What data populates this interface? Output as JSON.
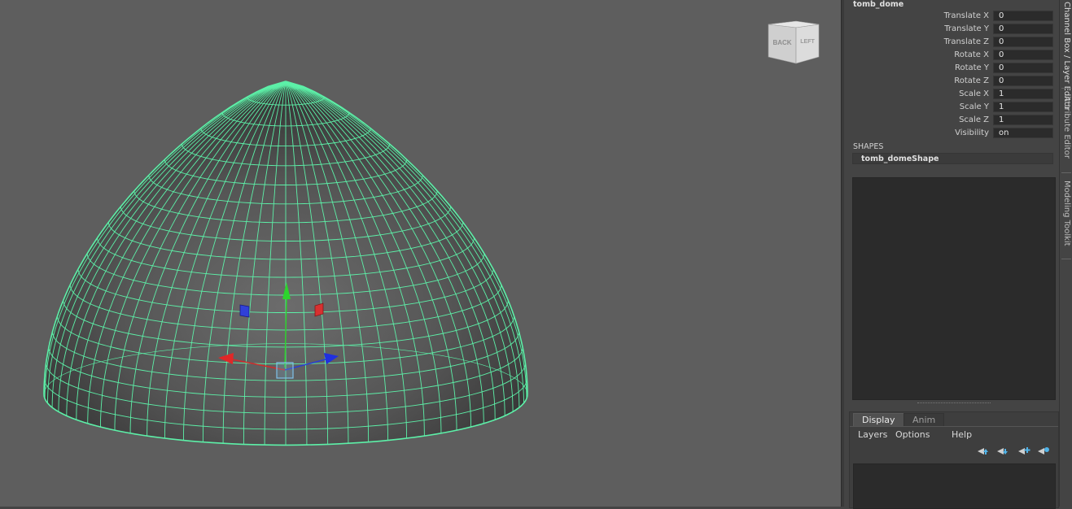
{
  "viewport": {
    "wireframe_color": "#5df0a8",
    "background_color": "#5e5e5e"
  },
  "viewcube": {
    "face_front": "BACK",
    "face_side": "LEFT"
  },
  "channel_box": {
    "object_name": "tomb_dome",
    "attributes": [
      {
        "label": "Translate X",
        "value": "0"
      },
      {
        "label": "Translate Y",
        "value": "0"
      },
      {
        "label": "Translate Z",
        "value": "0"
      },
      {
        "label": "Rotate X",
        "value": "0"
      },
      {
        "label": "Rotate Y",
        "value": "0"
      },
      {
        "label": "Rotate Z",
        "value": "0"
      },
      {
        "label": "Scale X",
        "value": "1"
      },
      {
        "label": "Scale Y",
        "value": "1"
      },
      {
        "label": "Scale Z",
        "value": "1"
      },
      {
        "label": "Visibility",
        "value": "on"
      }
    ],
    "shapes_heading": "SHAPES",
    "shape_name": "tomb_domeShape"
  },
  "layer_editor": {
    "tabs": [
      "Display",
      "Anim"
    ],
    "active_tab": "Display",
    "menu": [
      "Layers",
      "Options",
      "Help"
    ],
    "icons": [
      "move-layer-up-icon",
      "move-layer-down-icon",
      "new-empty-layer-icon",
      "new-layer-from-selected-icon"
    ]
  },
  "side_tabs": [
    "Channel Box / Layer Editor",
    "Attribute Editor",
    "Modeling Toolkit"
  ]
}
